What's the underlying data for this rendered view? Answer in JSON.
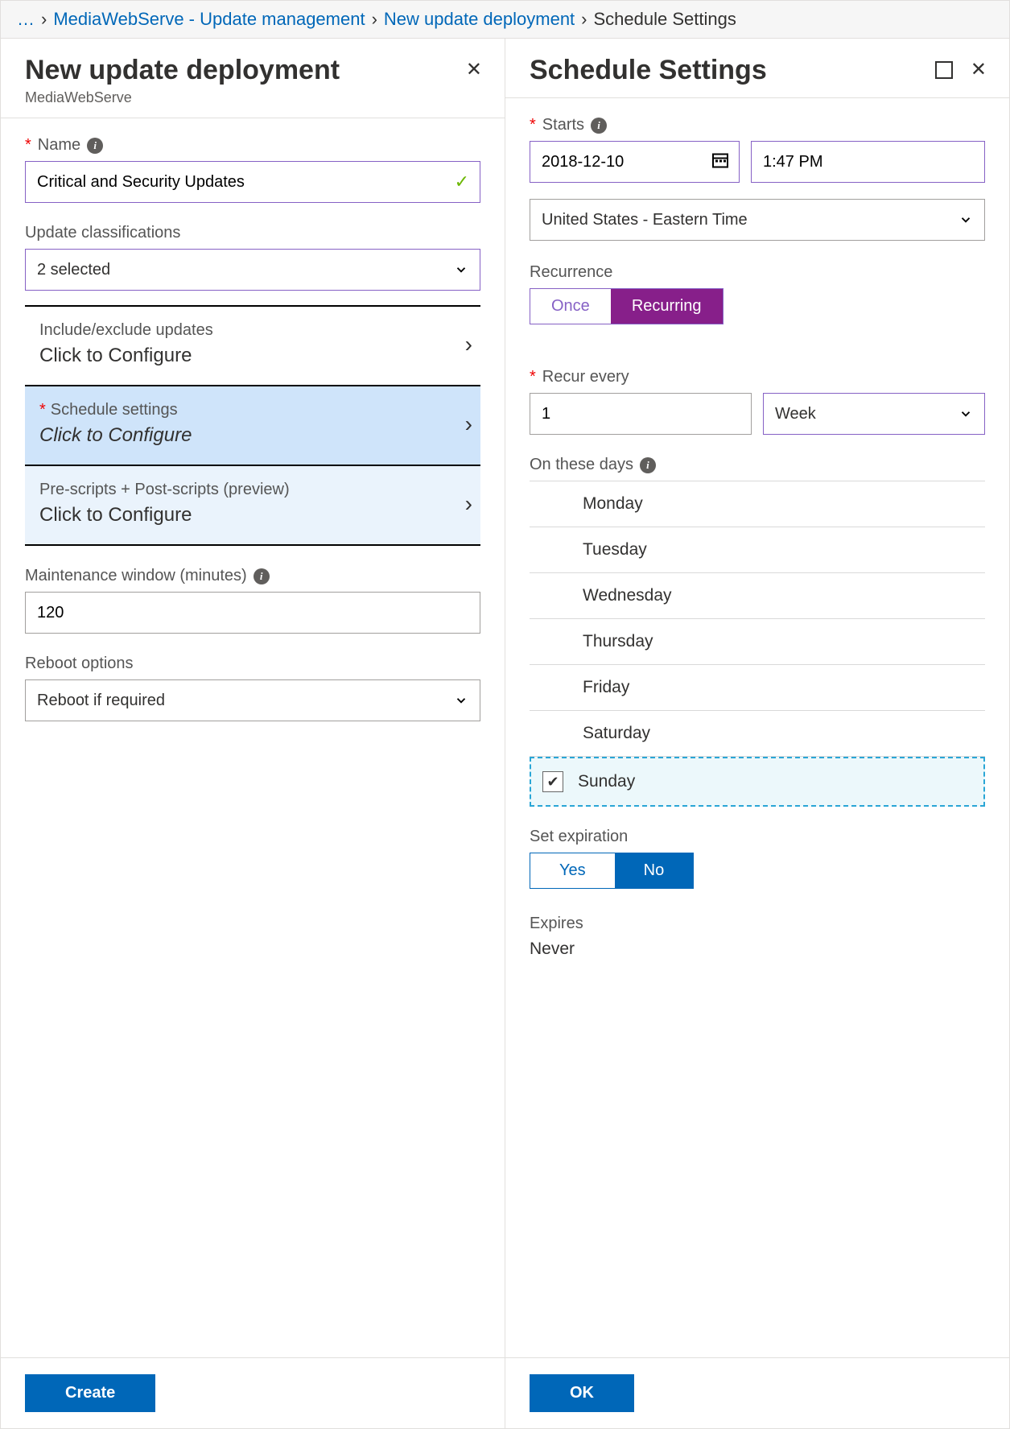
{
  "breadcrumb": {
    "ellipsis": "…",
    "items": [
      {
        "label": "MediaWebServe - Update management",
        "link": true
      },
      {
        "label": "New update deployment",
        "link": true
      },
      {
        "label": "Schedule Settings",
        "link": false
      }
    ]
  },
  "leftPane": {
    "title": "New update deployment",
    "subtitle": "MediaWebServe",
    "fields": {
      "name": {
        "label": "Name",
        "required": true,
        "value": "Critical and Security Updates",
        "validated": true
      },
      "classifications": {
        "label": "Update classifications",
        "value": "2 selected"
      },
      "includeExclude": {
        "title": "Include/exclude updates",
        "value": "Click to Configure"
      },
      "schedule": {
        "title": "Schedule settings",
        "required": true,
        "value": "Click to Configure"
      },
      "scripts": {
        "title": "Pre-scripts + Post-scripts (preview)",
        "value": "Click to Configure"
      },
      "maintenance": {
        "label": "Maintenance window (minutes)",
        "value": "120"
      },
      "reboot": {
        "label": "Reboot options",
        "value": "Reboot if required"
      }
    },
    "footerButton": "Create"
  },
  "rightPane": {
    "title": "Schedule Settings",
    "starts": {
      "label": "Starts",
      "required": true,
      "date": "2018-12-10",
      "time": "1:47 PM"
    },
    "timezone": {
      "value": "United States - Eastern Time"
    },
    "recurrence": {
      "label": "Recurrence",
      "options": [
        "Once",
        "Recurring"
      ],
      "selected": "Recurring"
    },
    "recurEvery": {
      "label": "Recur every",
      "required": true,
      "value": "1",
      "unit": "Week"
    },
    "days": {
      "label": "On these days",
      "list": [
        "Monday",
        "Tuesday",
        "Wednesday",
        "Thursday",
        "Friday",
        "Saturday",
        "Sunday"
      ],
      "selected": "Sunday"
    },
    "expiration": {
      "label": "Set expiration",
      "options": [
        "Yes",
        "No"
      ],
      "selected": "No"
    },
    "expires": {
      "label": "Expires",
      "value": "Never"
    },
    "footerButton": "OK"
  }
}
